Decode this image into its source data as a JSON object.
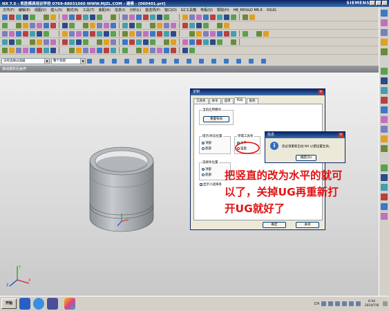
{
  "window": {
    "title": "NX 7.5 - 凯胜模具培训学校  0769-88031060  WWW.MJZL.COM - 建模 - [060401.prt]",
    "brand": "SIEMENS"
  },
  "menu": [
    "文件(F)",
    "编辑(E)",
    "视图(V)",
    "插入(S)",
    "格式(R)",
    "工具(T)",
    "装配(A)",
    "信息(I)",
    "分析(L)",
    "首选项(P)",
    "窗口(O)",
    "GC工具箱",
    "电极(Q)",
    "帮助(H)",
    "HB_MOULD M6.6",
    "XSUG"
  ],
  "selection_bar": {
    "filter_value": "没有选择过滤器",
    "scope_value": "整个装配"
  },
  "viewport": {
    "title": "抽油烟机后盖壳"
  },
  "dialog": {
    "title": "定制",
    "tabs": [
      "工具条",
      "命令",
      "选项",
      "布局",
      "角色"
    ],
    "active_tab": "布局",
    "group_current_app": {
      "title": "当前应用模块",
      "reset_button": "重置布局"
    },
    "group_prompt_status": {
      "title": "提示/状态位置",
      "options": [
        "顶部",
        "底部"
      ],
      "selected": "顶部"
    },
    "group_toolbar_orient": {
      "title": "停靠工具条",
      "options": [
        "水平",
        "竖直"
      ],
      "selected": "水平"
    },
    "group_selection_bar": {
      "title": "选择条位置",
      "options": [
        "顶部",
        "底部"
      ],
      "selected": "顶部"
    },
    "checkbox_label": "显示小选择条",
    "ok_button": "确定",
    "close_button": "关闭"
  },
  "info_popup": {
    "title": "信息",
    "message": "您必须重新启动 NX 以使设置生效。",
    "ok_button": "确定(O)"
  },
  "annotation": "把竖直的改为水平的就可以了，关掉UG再重新打开UG就好了",
  "taskbar": {
    "start_label": "开始",
    "tray_lang": "CH",
    "clock_time": "6:54",
    "clock_date": "2014/7/8"
  },
  "colors": {
    "titlebar": "#0a246a",
    "annotation": "#e01515",
    "ring": "#a9aeb3"
  }
}
